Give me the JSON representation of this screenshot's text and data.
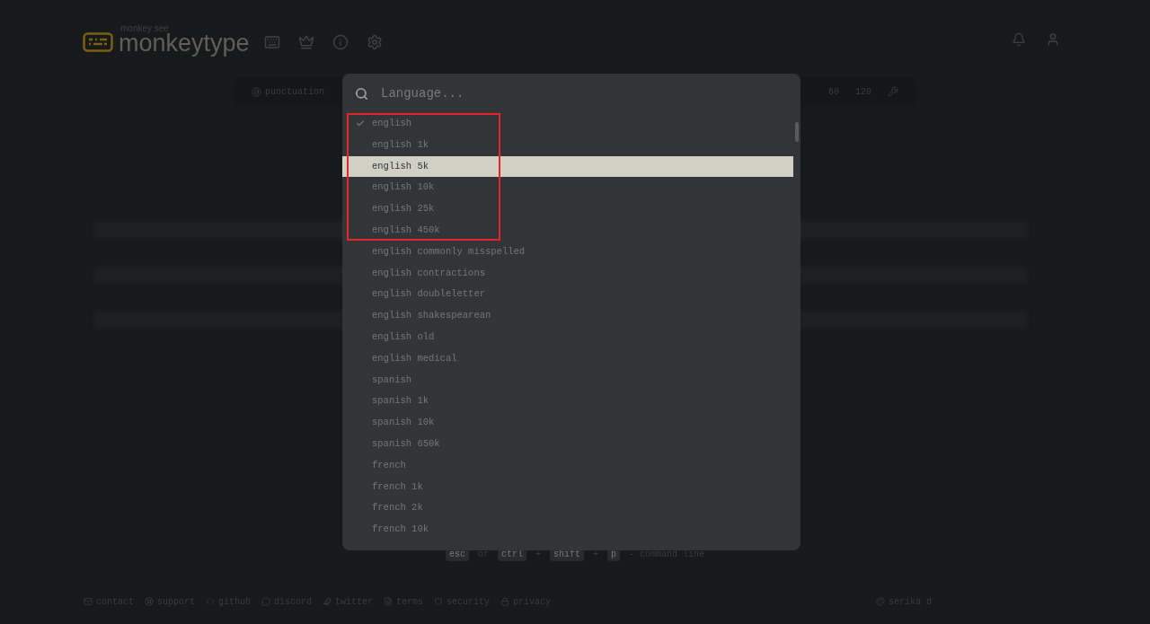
{
  "header": {
    "logo_caption": "monkey see",
    "logo_text": "monkeytype"
  },
  "config_bar": {
    "left": [
      "punctuation"
    ],
    "times": [
      "60",
      "120"
    ]
  },
  "command_line": {
    "placeholder": "Language...",
    "items": [
      {
        "label": "english",
        "checked": true,
        "selected": false
      },
      {
        "label": "english 1k",
        "checked": false,
        "selected": false
      },
      {
        "label": "english 5k",
        "checked": false,
        "selected": true
      },
      {
        "label": "english 10k",
        "checked": false,
        "selected": false
      },
      {
        "label": "english 25k",
        "checked": false,
        "selected": false
      },
      {
        "label": "english 450k",
        "checked": false,
        "selected": false
      },
      {
        "label": "english commonly misspelled",
        "checked": false,
        "selected": false
      },
      {
        "label": "english contractions",
        "checked": false,
        "selected": false
      },
      {
        "label": "english doubleletter",
        "checked": false,
        "selected": false
      },
      {
        "label": "english shakespearean",
        "checked": false,
        "selected": false
      },
      {
        "label": "english old",
        "checked": false,
        "selected": false
      },
      {
        "label": "english medical",
        "checked": false,
        "selected": false
      },
      {
        "label": "spanish",
        "checked": false,
        "selected": false
      },
      {
        "label": "spanish 1k",
        "checked": false,
        "selected": false
      },
      {
        "label": "spanish 10k",
        "checked": false,
        "selected": false
      },
      {
        "label": "spanish 650k",
        "checked": false,
        "selected": false
      },
      {
        "label": "french",
        "checked": false,
        "selected": false
      },
      {
        "label": "french 1k",
        "checked": false,
        "selected": false
      },
      {
        "label": "french 2k",
        "checked": false,
        "selected": false
      },
      {
        "label": "french 10k",
        "checked": false,
        "selected": false
      }
    ]
  },
  "hint": {
    "keys": [
      "esc",
      "ctrl",
      "shift",
      "p"
    ],
    "or": "or",
    "plus": [
      "+",
      "+"
    ],
    "label": "- command line"
  },
  "footer": {
    "links": [
      {
        "label": "contact"
      },
      {
        "label": "support"
      },
      {
        "label": "github"
      },
      {
        "label": "discord"
      },
      {
        "label": "twitter"
      },
      {
        "label": "terms"
      },
      {
        "label": "security"
      },
      {
        "label": "privacy"
      }
    ],
    "theme": "serika d"
  }
}
